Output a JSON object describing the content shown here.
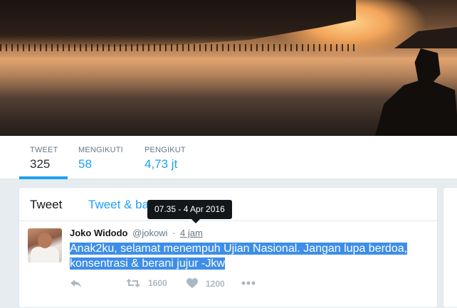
{
  "profile_nav": {
    "stats": [
      {
        "label": "TWEET",
        "value": "325"
      },
      {
        "label": "MENGIKUTI",
        "value": "58"
      },
      {
        "label": "PENGIKUT",
        "value": "4,73 jt"
      }
    ]
  },
  "tweet_card": {
    "tabs": {
      "tweet": "Tweet",
      "replies": "Tweet & ba",
      "replies_tail": "a"
    },
    "tooltip": "07.35 - 4 Apr 2016",
    "author": {
      "name": "Joko Widodo",
      "handle": "@jokowi",
      "separator": "·",
      "time": "4 jam"
    },
    "text_line1": "Anak2ku, selamat menempuh Ujian Nasional. Jangan lupa berdoa,",
    "text_line2": "konsentrasi & berani jujur -Jkw",
    "retweet_count": "1600",
    "like_count": "1200"
  },
  "colors": {
    "accent": "#1da1f2",
    "selection": "#3d8ee8",
    "muted": "#aab8c2"
  },
  "icons": [
    "reply-icon",
    "retweet-icon",
    "heart-icon",
    "more-icon"
  ]
}
